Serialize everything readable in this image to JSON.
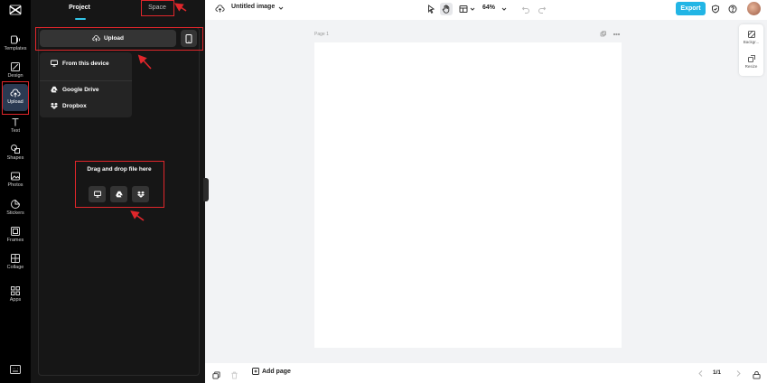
{
  "rail": {
    "items": [
      {
        "label": "Templates",
        "icon": "templates-icon"
      },
      {
        "label": "Design",
        "icon": "design-icon"
      },
      {
        "label": "Upload",
        "icon": "cloud-upload-icon"
      },
      {
        "label": "Text",
        "icon": "text-icon"
      },
      {
        "label": "Shapes",
        "icon": "shapes-icon"
      },
      {
        "label": "Photos",
        "icon": "photos-icon"
      },
      {
        "label": "Stickers",
        "icon": "stickers-icon"
      },
      {
        "label": "Frames",
        "icon": "frames-icon"
      },
      {
        "label": "Collage",
        "icon": "collage-icon"
      },
      {
        "label": "Apps",
        "icon": "apps-icon"
      }
    ],
    "active": "Upload"
  },
  "panel": {
    "tabs": {
      "project": "Project",
      "space": "Space"
    },
    "upload_button": "Upload",
    "dropdown": {
      "from_device": "From this device",
      "google_drive": "Google Drive",
      "dropbox": "Dropbox"
    },
    "drop_zone_text": "Drag and drop file here"
  },
  "topbar": {
    "title": "Untitled image",
    "zoom": "64%",
    "export_label": "Export"
  },
  "canvas": {
    "page_label": "Page 1"
  },
  "right_float": {
    "background_label": "Backgr...",
    "resize_label": "Resize"
  },
  "bottombar": {
    "add_page_label": "Add page",
    "page_count": "1/1"
  },
  "colors": {
    "accent": "#22b5e5",
    "annotation": "#e0262b",
    "rail_bg": "#000000",
    "panel_bg": "#161616"
  }
}
